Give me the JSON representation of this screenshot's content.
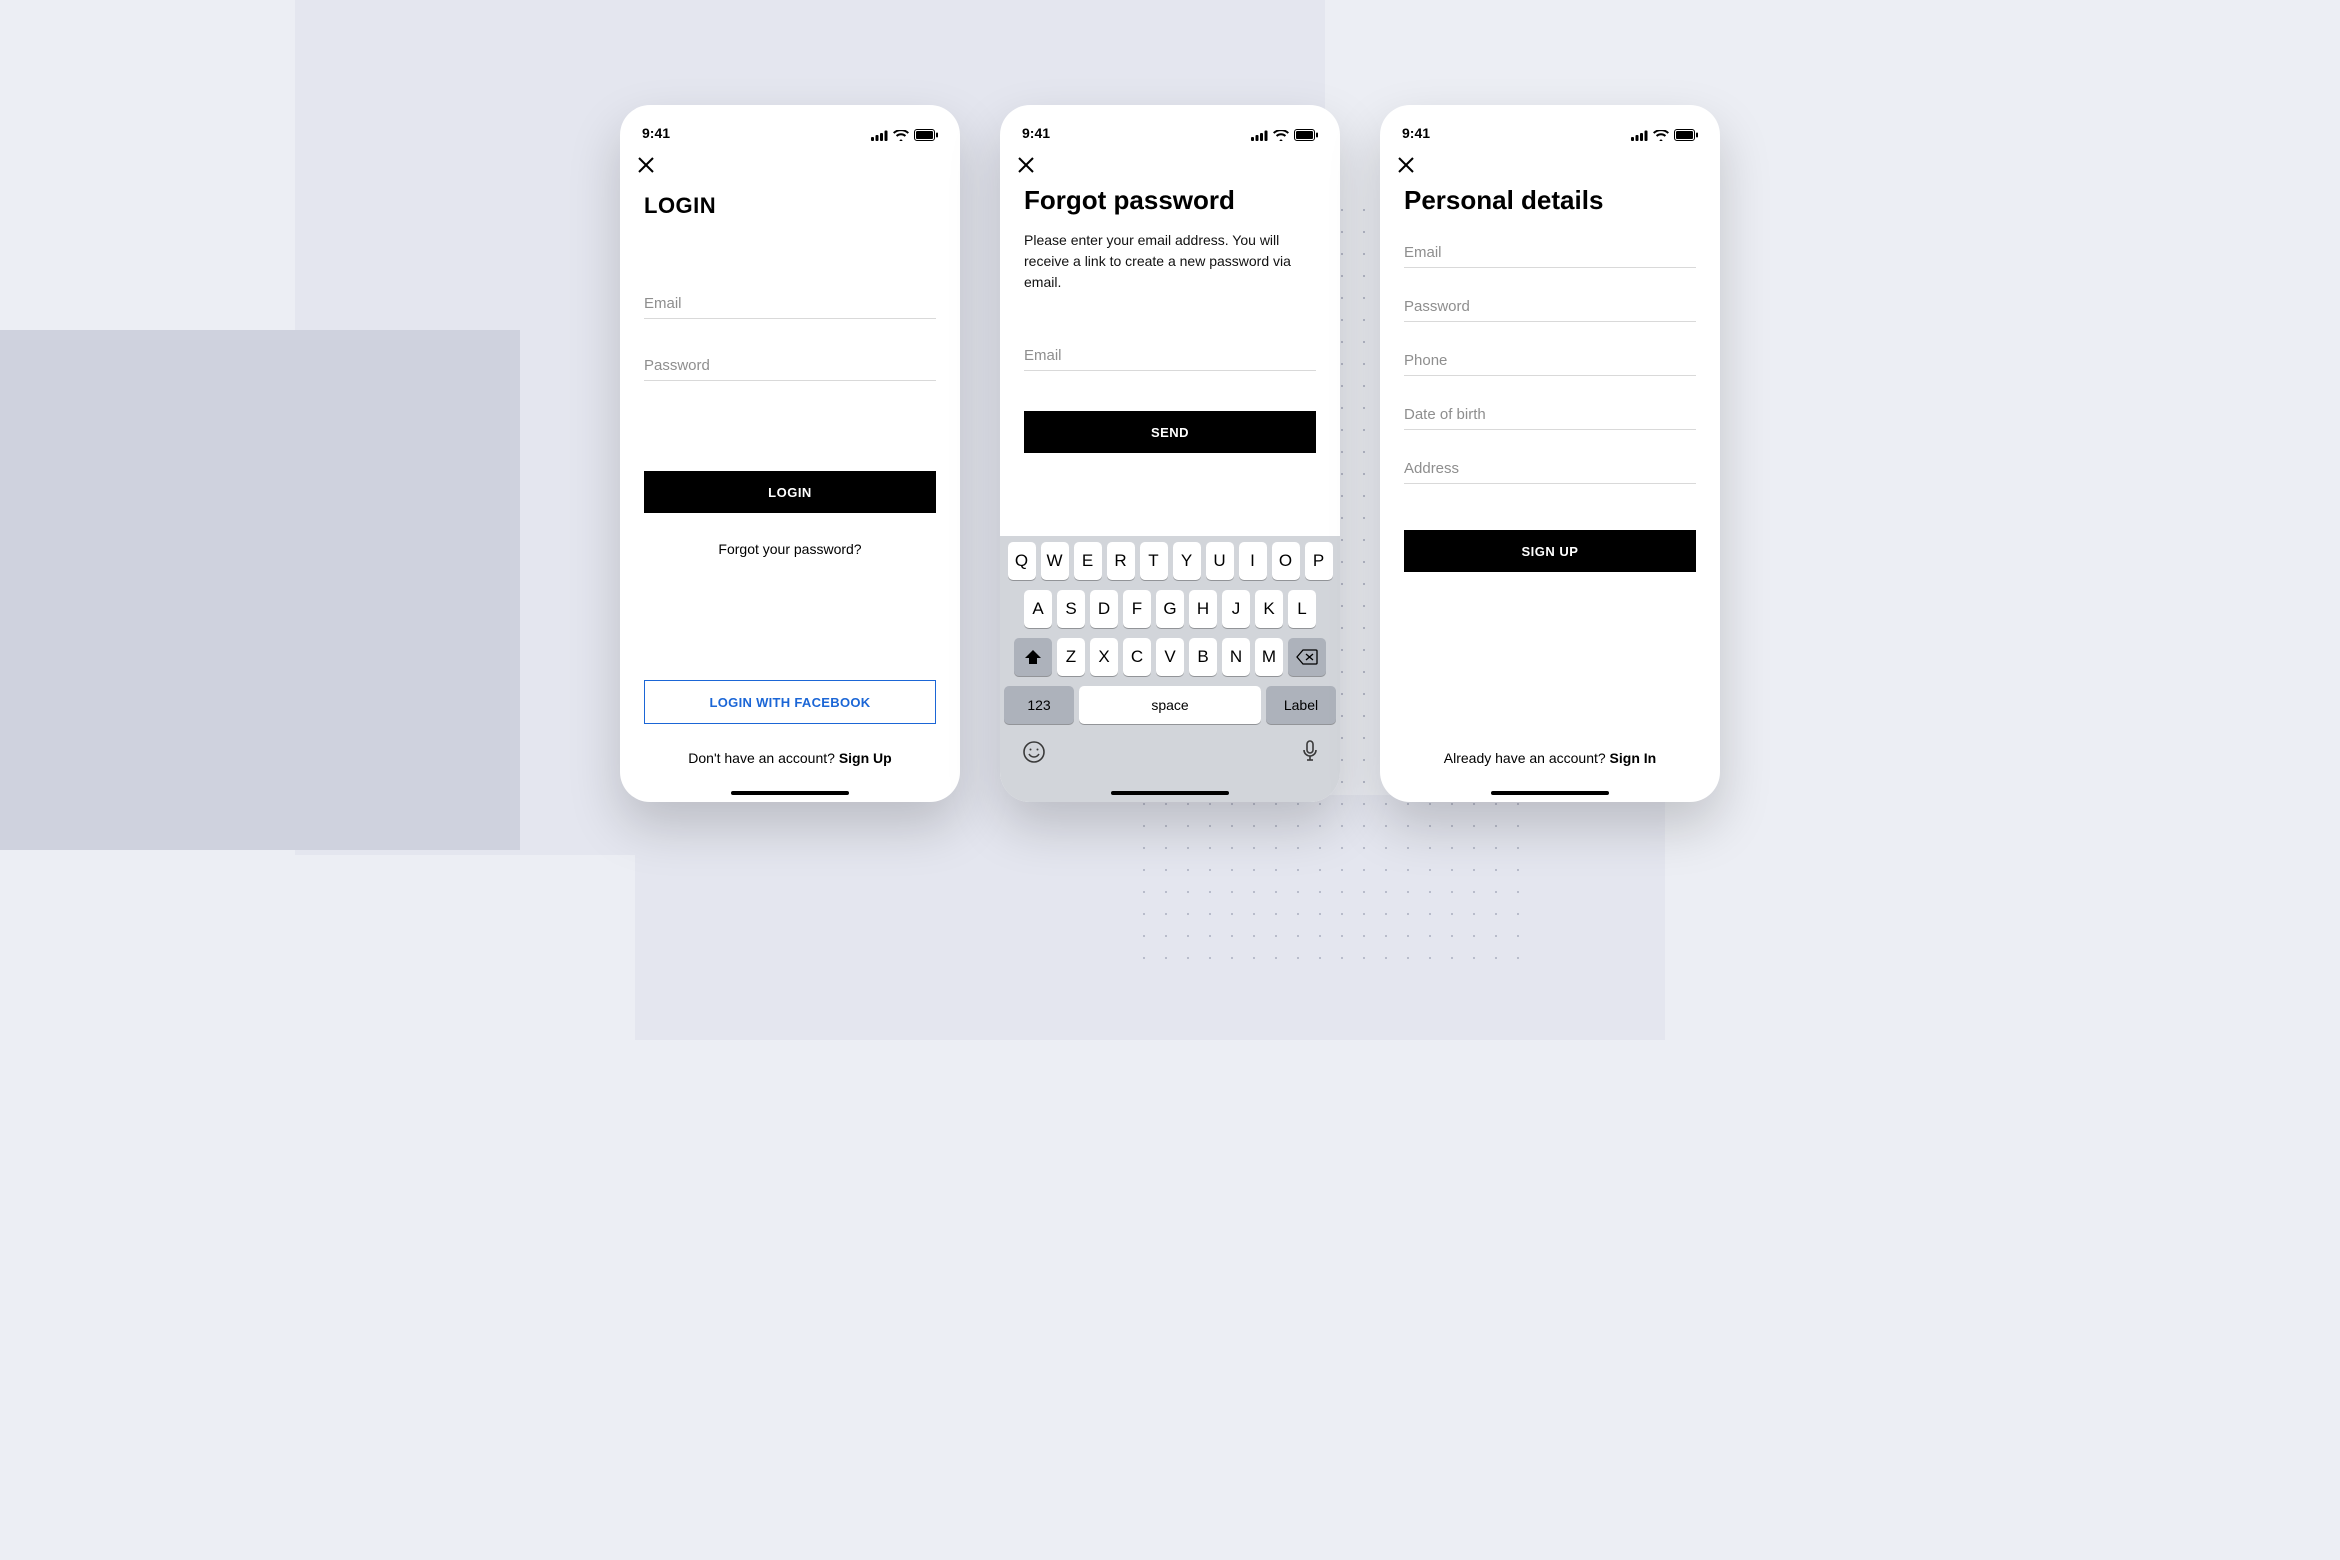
{
  "status_time": "9:41",
  "colors": {
    "fb_blue": "#1b66d6"
  },
  "login": {
    "title": "LOGIN",
    "email_placeholder": "Email",
    "password_placeholder": "Password",
    "login_button": "LOGIN",
    "forgot_link": "Forgot your password?",
    "facebook_button": "LOGIN WITH FACEBOOK",
    "footer_prompt": "Don't have an account? ",
    "footer_action": "Sign Up"
  },
  "forgot": {
    "title": "Forgot password",
    "description": "Please enter your email address. You will receive a link to create a new password via email.",
    "email_placeholder": "Email",
    "send_button": "SEND"
  },
  "signup": {
    "title": "Personal details",
    "email_placeholder": "Email",
    "password_placeholder": "Password",
    "phone_placeholder": "Phone",
    "dob_placeholder": "Date of birth",
    "address_placeholder": "Address",
    "signup_button": "SIGN UP",
    "footer_prompt": "Already have an account? ",
    "footer_action": "Sign In"
  },
  "keyboard": {
    "row1": [
      "Q",
      "W",
      "E",
      "R",
      "T",
      "Y",
      "U",
      "I",
      "O",
      "P"
    ],
    "row2": [
      "A",
      "S",
      "D",
      "F",
      "G",
      "H",
      "J",
      "K",
      "L"
    ],
    "row3": [
      "Z",
      "X",
      "C",
      "V",
      "B",
      "N",
      "M"
    ],
    "num_key": "123",
    "space_key": "space",
    "label_key": "Label"
  }
}
